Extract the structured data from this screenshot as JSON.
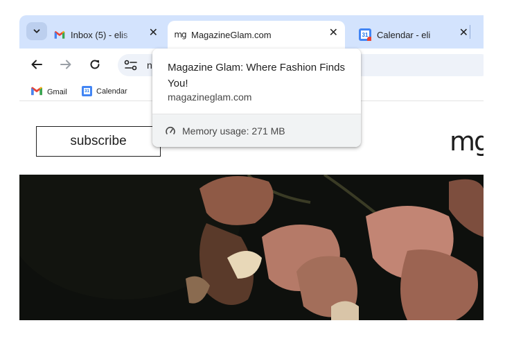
{
  "tabs": [
    {
      "title": "Inbox (5) - elis",
      "favicon": "gmail-icon",
      "close": "✕"
    },
    {
      "title": "MagazineGlam.com",
      "favicon": "mg-site-icon",
      "favicon_text": "mg",
      "close": "✕",
      "active": true
    },
    {
      "title": "Calendar - eli",
      "favicon": "calendar-icon",
      "favicon_text": "31",
      "close": "✕"
    }
  ],
  "toolbar": {
    "address_text": "n"
  },
  "bookmarks": [
    {
      "label": "Gmail",
      "icon": "gmail-icon"
    },
    {
      "label": "Calendar",
      "icon": "calendar-icon",
      "icon_text": "31"
    }
  ],
  "hovercard": {
    "title": "Magazine Glam: Where Fashion Finds You!",
    "domain": "magazineglam.com",
    "memory": "Memory usage: 271 MB"
  },
  "page": {
    "subscribe_label": "subscribe",
    "logo_text": "mg"
  },
  "colors": {
    "tabstrip": "#d3e3fd",
    "omnibox": "#eef2f9",
    "gmail_red": "#ea4335",
    "calendar_blue": "#4285f4"
  }
}
